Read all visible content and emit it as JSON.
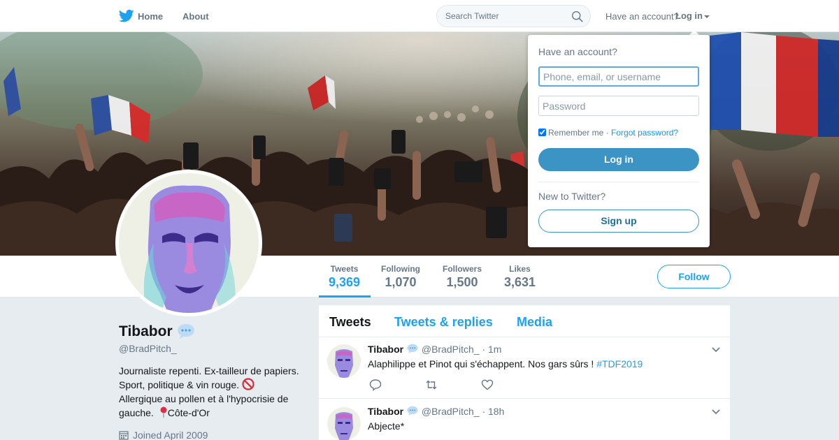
{
  "nav": {
    "home_label": "Home",
    "about_label": "About",
    "search_placeholder": "Search Twitter",
    "have_account": "Have an account?",
    "login_label": "Log in"
  },
  "profile_stats": [
    {
      "label": "Tweets",
      "value": "9,369"
    },
    {
      "label": "Following",
      "value": "1,070"
    },
    {
      "label": "Followers",
      "value": "1,500"
    },
    {
      "label": "Likes",
      "value": "3,631"
    }
  ],
  "follow_label": "Follow",
  "profile": {
    "name": "Tibabor",
    "handle": "@BradPitch_",
    "bio_line1": "Journaliste repenti. Ex-tailleur de papiers.",
    "bio_line2": "Sport, politique & vin rouge.",
    "bio_line3": "Allergique au pollen et à l'hypocrisie de",
    "bio_line4": "gauche.",
    "location": "Côte-d'Or",
    "joined": "Joined April 2009"
  },
  "timeline_tabs": [
    "Tweets",
    "Tweets & replies",
    "Media"
  ],
  "tweets": [
    {
      "name": "Tibabor",
      "handle": "@BradPitch_",
      "time": "· 1m",
      "text": "Alaphilippe et Pinot qui s'échappent. Nos gars sûrs !",
      "hashtag": "#TDF2019"
    },
    {
      "name": "Tibabor",
      "handle": "@BradPitch_",
      "time": "· 18h",
      "text": "Abjecte*"
    }
  ],
  "login_dropdown": {
    "title": "Have an account?",
    "username_placeholder": "Phone, email, or username",
    "password_placeholder": "Password",
    "remember": "Remember me",
    "separator": "·",
    "forgot": "Forgot password?",
    "login_button": "Log in",
    "new_to": "New to Twitter?",
    "signup_button": "Sign up"
  },
  "colors": {
    "brand_blue": "#1da1f2",
    "login_button": "#3b94c4",
    "background": "#e6ecf0"
  },
  "icons": [
    "twitter-bird-icon",
    "search-icon",
    "caret-down-icon",
    "speech-bubble-icon",
    "no-entry-icon",
    "pin-icon",
    "calendar-icon",
    "chevron-down-icon",
    "reply-icon",
    "retweet-icon",
    "like-icon"
  ]
}
